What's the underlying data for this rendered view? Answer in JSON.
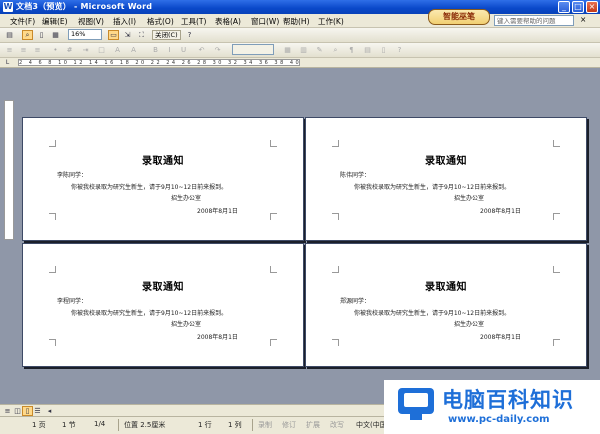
{
  "window": {
    "title": "文档3（预览） - Microsoft Word",
    "buttons": [
      "minimize",
      "maximize",
      "close"
    ]
  },
  "menu": {
    "items": [
      "文件(F)",
      "编辑(E)",
      "视图(V)",
      "插入(I)",
      "格式(O)",
      "工具(T)",
      "表格(A)",
      "窗口(W)",
      "帮助(H)",
      "工作(K)"
    ],
    "help_placeholder": "键入需要帮助的问题",
    "logo_text": "智能巫笔"
  },
  "preview_toolbar": {
    "zoom": "16%",
    "close_label": "关闭(C)"
  },
  "pages": [
    {
      "title": "录取通知",
      "greeting": "李陈同学：",
      "body": "你被我校录取为研究生新生，请于9月10~12日前来报到。",
      "office": "招生办公室",
      "date": "2008年8月1日"
    },
    {
      "title": "录取通知",
      "greeting": "陈伟同学：",
      "body": "你被我校录取为研究生新生，请于9月10~12日前来报到。",
      "office": "招生办公室",
      "date": "2008年8月1日"
    },
    {
      "title": "录取通知",
      "greeting": "李程同学：",
      "body": "你被我校录取为研究生新生，请于9月10~12日前来报到。",
      "office": "招生办公室",
      "date": "2008年8月1日"
    },
    {
      "title": "录取通知",
      "greeting": "郑源同学：",
      "body": "你被我校录取为研究生新生，请于9月10~12日前来报到。",
      "office": "招生办公室",
      "date": "2008年8月1日"
    }
  ],
  "statusbar": {
    "page": "1 页",
    "section": "1 节",
    "page_of": "1/4",
    "position": "位置 2.5厘米",
    "line": "1 行",
    "column": "1 列",
    "modes": [
      "录制",
      "修订",
      "扩展",
      "改写"
    ],
    "language": "中文(中国)"
  },
  "watermark": {
    "text": "电脑百科知识",
    "url": "www.pc-daily.com"
  },
  "colors": {
    "titlebar": "#0a48c9",
    "workspace": "#8f97a8",
    "watermark": "#1e6fd8"
  }
}
